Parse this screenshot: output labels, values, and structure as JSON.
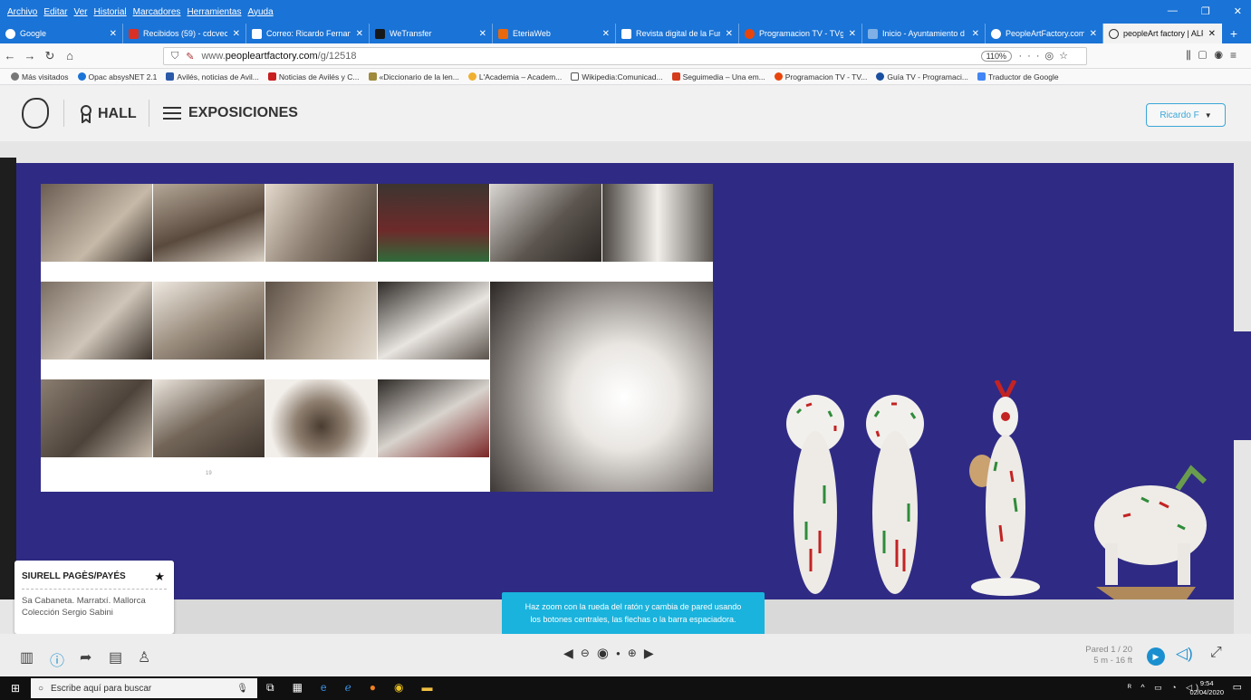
{
  "menubar": {
    "items": [
      "Archivo",
      "Editar",
      "Ver",
      "Historial",
      "Marcadores",
      "Herramientas",
      "Ayuda"
    ],
    "controls": [
      "—",
      "❐",
      "✕"
    ]
  },
  "tabs": [
    {
      "label": "Google",
      "color": "#4285f4"
    },
    {
      "label": "Recibidos (59) - cdcvec",
      "color": "#d93025"
    },
    {
      "label": "Correo: Ricardo Fernan",
      "color": "#0b5cad"
    },
    {
      "label": "WeTransfer",
      "color": "#17181a"
    },
    {
      "label": "EteriaWeb",
      "color": "#e8680c"
    },
    {
      "label": "Revista digital de la Fun",
      "color": "#555555"
    },
    {
      "label": "Programacion TV - TVg",
      "color": "#e8450c"
    },
    {
      "label": "Inicio - Ayuntamiento d",
      "color": "#2e7fd1"
    },
    {
      "label": "PeopleArtFactory.com |",
      "color": "#ffffff"
    },
    {
      "label": "peopleArt factory | ALFA",
      "color": "#333333"
    }
  ],
  "address": {
    "prefix": "www.",
    "domain": "peopleartfactory.com",
    "path": "/g/12518",
    "zoom": "110%"
  },
  "bookmarks": [
    {
      "label": "Más visitados",
      "color": "#777777"
    },
    {
      "label": "Opac absysNET 2.1",
      "color": "#1a73d6"
    },
    {
      "label": "Avilés, noticias de Avil...",
      "color": "#2b5aa8"
    },
    {
      "label": "Noticias de Avilés y C...",
      "color": "#c81e1e"
    },
    {
      "label": "«Diccionario de la len...",
      "color": "#a08a3c"
    },
    {
      "label": "L'Academia – Academ...",
      "color": "#f0b030"
    },
    {
      "label": "Wikipedia:Comunicad...",
      "color": "#555555"
    },
    {
      "label": "Seguimedia – Una em...",
      "color": "#d43c1c"
    },
    {
      "label": "Programacion TV - TV...",
      "color": "#e8450c"
    },
    {
      "label": "Guía TV - Programaci...",
      "color": "#1a4fa0"
    },
    {
      "label": "Traductor de Google",
      "color": "#4285f4"
    }
  ],
  "header": {
    "hall": "HALL",
    "exhibitions": "EXPOSICIONES",
    "user": "Ricardo F"
  },
  "collage": {
    "page_number": "19"
  },
  "info": {
    "title": "SIURELL PAGÈS/PAYÉS",
    "location": "Sa Cabaneta. Marratxí. Mallorca",
    "collection": "Colección Sergio Sabini"
  },
  "tooltip": {
    "line1": "Haz zoom con la rueda del ratón y cambia de pared usando",
    "line2": "los botones centrales, las flechas o la barra espaciadora."
  },
  "controls": {
    "pared": "Pared 1 / 20",
    "size": "5 m - 16 ft"
  },
  "taskbar": {
    "search_placeholder": "Escribe aquí para buscar",
    "time": "9:54",
    "date": "02/04/2020"
  },
  "colors": {
    "wall": "#2f2b84",
    "accent": "#1ab3dd",
    "browser": "#1a73d6"
  }
}
